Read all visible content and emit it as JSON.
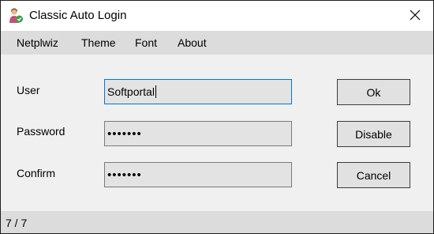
{
  "window": {
    "title": "Classic Auto Login",
    "icon": "person-key-icon",
    "close_icon": "close-icon"
  },
  "menu": {
    "items": [
      {
        "label": "Netplwiz"
      },
      {
        "label": "Theme"
      },
      {
        "label": "Font"
      },
      {
        "label": "About"
      }
    ]
  },
  "form": {
    "user": {
      "label": "User",
      "value": "Softportal"
    },
    "password": {
      "label": "Password",
      "value": "•••••••"
    },
    "confirm": {
      "label": "Confirm",
      "value": "•••••••"
    }
  },
  "buttons": {
    "ok": "Ok",
    "disable": "Disable",
    "cancel": "Cancel"
  },
  "status": {
    "text": "7 / 7"
  },
  "colors": {
    "focus_border": "#0078d7",
    "menubar_bg": "#dcdcdc",
    "field_bg": "#e3e3e3"
  }
}
